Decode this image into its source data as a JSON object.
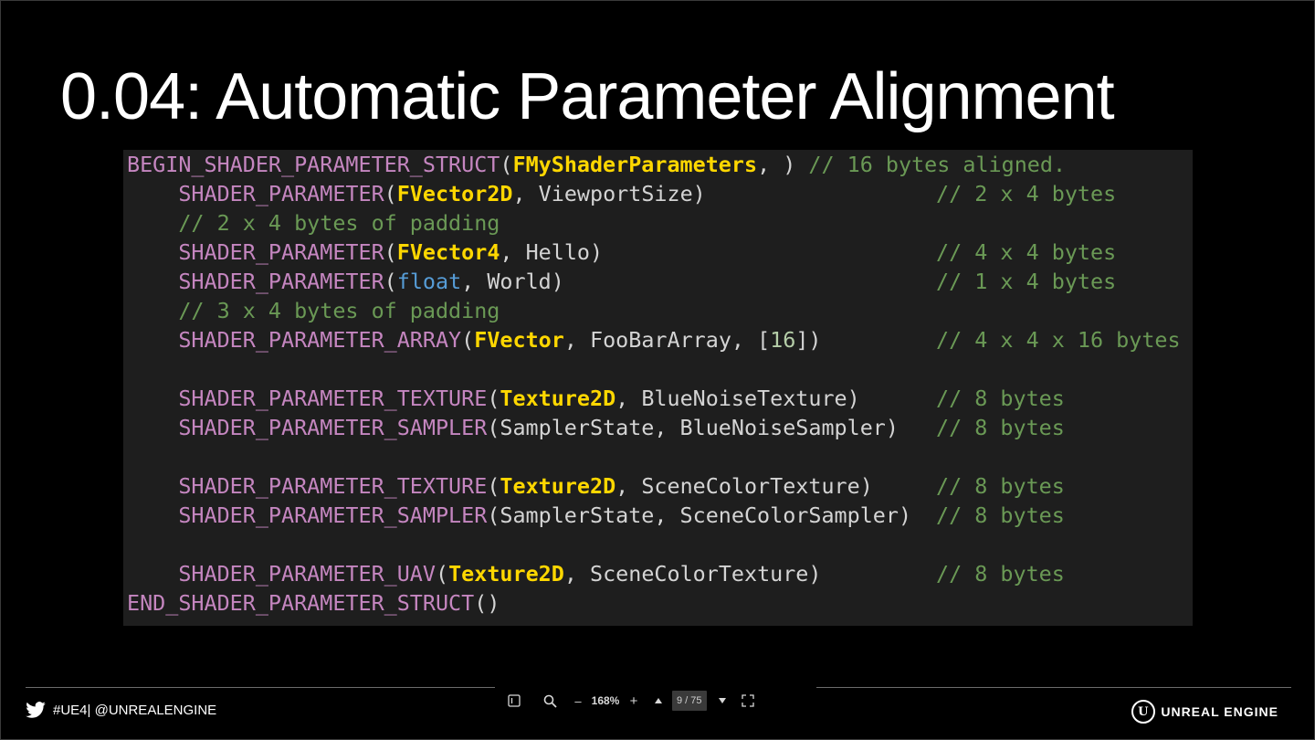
{
  "slide": {
    "title": "0.04: Automatic Parameter Alignment"
  },
  "code": {
    "lines": [
      {
        "segments": [
          {
            "t": "BEGIN_SHADER_PARAMETER_STRUCT",
            "c": "macro"
          },
          {
            "t": "(",
            "c": "ident"
          },
          {
            "t": "FMyShaderParameters",
            "c": "type"
          },
          {
            "t": ", ) ",
            "c": "ident"
          },
          {
            "t": "// 16 bytes aligned.",
            "c": "comment"
          }
        ],
        "comment": ""
      },
      {
        "segments": [
          {
            "t": "    SHADER_PARAMETER",
            "c": "macro"
          },
          {
            "t": "(",
            "c": "ident"
          },
          {
            "t": "FVector2D",
            "c": "type"
          },
          {
            "t": ", ViewportSize)",
            "c": "ident"
          }
        ],
        "comment": "// 2 x 4 bytes"
      },
      {
        "segments": [
          {
            "t": "    // 2 x 4 bytes of padding",
            "c": "comment"
          }
        ],
        "comment": ""
      },
      {
        "segments": [
          {
            "t": "    SHADER_PARAMETER",
            "c": "macro"
          },
          {
            "t": "(",
            "c": "ident"
          },
          {
            "t": "FVector4",
            "c": "type"
          },
          {
            "t": ", Hello)",
            "c": "ident"
          }
        ],
        "comment": "// 4 x 4 bytes"
      },
      {
        "segments": [
          {
            "t": "    SHADER_PARAMETER",
            "c": "macro"
          },
          {
            "t": "(",
            "c": "ident"
          },
          {
            "t": "float",
            "c": "kw"
          },
          {
            "t": ", World)",
            "c": "ident"
          }
        ],
        "comment": "// 1 x 4 bytes"
      },
      {
        "segments": [
          {
            "t": "    // 3 x 4 bytes of padding",
            "c": "comment"
          }
        ],
        "comment": ""
      },
      {
        "segments": [
          {
            "t": "    SHADER_PARAMETER_ARRAY",
            "c": "macro"
          },
          {
            "t": "(",
            "c": "ident"
          },
          {
            "t": "FVector",
            "c": "type"
          },
          {
            "t": ", FooBarArray, [",
            "c": "ident"
          },
          {
            "t": "16",
            "c": "num"
          },
          {
            "t": "])",
            "c": "ident"
          }
        ],
        "comment": "// 4 x 4 x 16 bytes"
      },
      {
        "segments": [],
        "comment": ""
      },
      {
        "segments": [
          {
            "t": "    SHADER_PARAMETER_TEXTURE",
            "c": "macro"
          },
          {
            "t": "(",
            "c": "ident"
          },
          {
            "t": "Texture2D",
            "c": "type"
          },
          {
            "t": ", BlueNoiseTexture)",
            "c": "ident"
          }
        ],
        "comment": "// 8 bytes"
      },
      {
        "segments": [
          {
            "t": "    SHADER_PARAMETER_SAMPLER",
            "c": "macro"
          },
          {
            "t": "(SamplerState, BlueNoiseSampler)",
            "c": "ident"
          }
        ],
        "comment": "// 8 bytes"
      },
      {
        "segments": [],
        "comment": ""
      },
      {
        "segments": [
          {
            "t": "    SHADER_PARAMETER_TEXTURE",
            "c": "macro"
          },
          {
            "t": "(",
            "c": "ident"
          },
          {
            "t": "Texture2D",
            "c": "type"
          },
          {
            "t": ", SceneColorTexture)",
            "c": "ident"
          }
        ],
        "comment": "// 8 bytes"
      },
      {
        "segments": [
          {
            "t": "    SHADER_PARAMETER_SAMPLER",
            "c": "macro"
          },
          {
            "t": "(SamplerState, SceneColorSampler)",
            "c": "ident"
          }
        ],
        "comment": "// 8 bytes"
      },
      {
        "segments": [],
        "comment": ""
      },
      {
        "segments": [
          {
            "t": "    SHADER_PARAMETER_UAV",
            "c": "macro"
          },
          {
            "t": "(",
            "c": "ident"
          },
          {
            "t": "Texture2D",
            "c": "type"
          },
          {
            "t": ", SceneColorTexture)",
            "c": "ident"
          }
        ],
        "comment": "// 8 bytes"
      },
      {
        "segments": [
          {
            "t": "END_SHADER_PARAMETER_STRUCT",
            "c": "macro"
          },
          {
            "t": "()",
            "c": "ident"
          }
        ],
        "comment": ""
      }
    ]
  },
  "footer": {
    "hashtag": "#UE4| @UNREALENGINE",
    "twitter_icon": "twitter-bird-icon",
    "logo_text": "UNREAL ENGINE",
    "logo_mark": "U"
  },
  "toolbar": {
    "zoom_out_label": "–",
    "zoom_level": "168%",
    "zoom_in_label": "+",
    "page_indicator": "9 / 75",
    "icons": [
      "sidebar-icon",
      "search-icon",
      "page-up-icon",
      "page-down-icon",
      "fullscreen-icon"
    ]
  },
  "colors": {
    "background": "#000000",
    "code_bg": "#1e1e1e",
    "macro": "#c586c0",
    "type": "#ffd700",
    "keyword": "#569cd6",
    "identifier": "#d4d4d4",
    "number": "#b5cea8",
    "comment": "#6a9955"
  }
}
